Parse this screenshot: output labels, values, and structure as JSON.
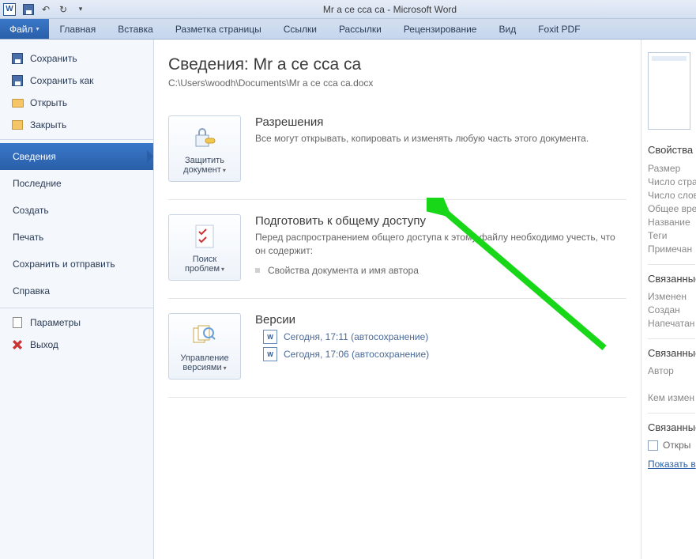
{
  "title_bar": {
    "title": "Mr a ce  cca ca  -  Microsoft Word"
  },
  "qat": {
    "word": "W"
  },
  "tabs": {
    "file": "Файл",
    "items": [
      "Главная",
      "Вставка",
      "Разметка страницы",
      "Ссылки",
      "Рассылки",
      "Рецензирование",
      "Вид",
      "Foxit PDF"
    ]
  },
  "nav": {
    "save": "Сохранить",
    "save_as": "Сохранить как",
    "open": "Открыть",
    "close": "Закрыть",
    "info": "Сведения",
    "recent": "Последние",
    "new": "Создать",
    "print": "Печать",
    "save_send": "Сохранить и отправить",
    "help": "Справка",
    "options": "Параметры",
    "exit": "Выход"
  },
  "info": {
    "title": "Сведения: Mr a ce  cca ca",
    "path": "C:\\Users\\woodh\\Documents\\Mr a ce  cca ca.docx"
  },
  "permissions": {
    "btn": "Защитить документ",
    "title": "Разрешения",
    "text": "Все могут открывать, копировать и изменять любую часть этого документа."
  },
  "prepare": {
    "btn": "Поиск проблем",
    "title": "Подготовить к общему доступу",
    "text": "Перед распространением общего доступа к этому файлу необходимо учесть, что он содержит:",
    "bullet": "Свойства документа и имя автора"
  },
  "versions": {
    "btn": "Управление версиями",
    "title": "Версии",
    "items": [
      "Сегодня, 17:11 (автосохранение)",
      "Сегодня, 17:06 (автосохранение)"
    ]
  },
  "props": {
    "head": "Свойства ▾",
    "size": "Размер",
    "pages": "Число стра",
    "words": "Число слов",
    "edit_time": "Общее вре",
    "name": "Название",
    "tags": "Теги",
    "comments": "Примечан",
    "related_dates": "Связанные",
    "modified": "Изменен",
    "created": "Создан",
    "printed": "Напечатан",
    "related_people": "Связанные",
    "author": "Автор",
    "last_mod_by": "Кем измен",
    "related_docs": "Связанные",
    "open_location": "Откры",
    "show_all": "Показать в"
  }
}
